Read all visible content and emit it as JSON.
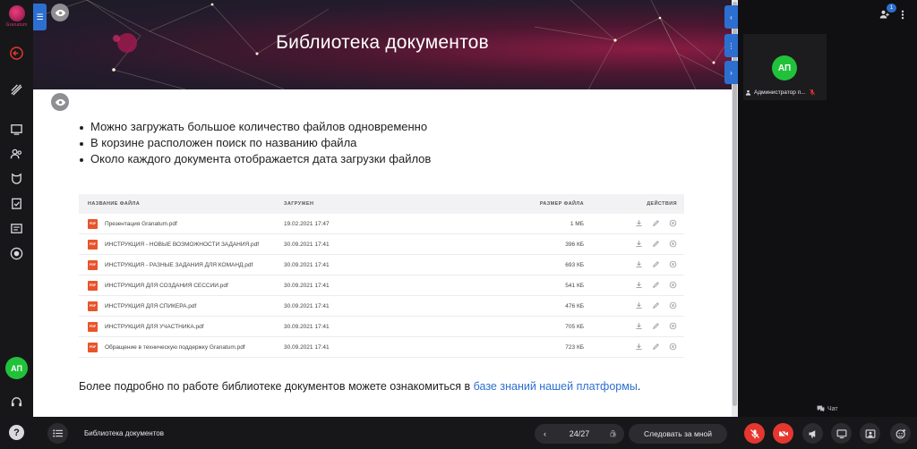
{
  "brand": {
    "name": "Granatum"
  },
  "slide": {
    "title": "Библиотека документов",
    "bullets": [
      "Можно загружать большое количество файлов одновременно",
      "В корзине расположен поиск по названию файла",
      "Около каждого документа отображается дата загрузки файлов"
    ],
    "table": {
      "headers": {
        "name": "НАЗВАНИЕ ФАЙЛА",
        "uploaded": "ЗАГРУЖЕН",
        "size": "РАЗМЕР ФАЙЛА",
        "actions": "ДЕЙСТВИЯ"
      },
      "file_badge": "PDF",
      "rows": [
        {
          "name": "Презентация Granatum.pdf",
          "uploaded": "19.02.2021 17:47",
          "size": "1 МБ"
        },
        {
          "name": "ИНСТРУКЦИЯ - НОВЫЕ ВОЗМОЖНОСТИ ЗАДАНИЯ.pdf",
          "uploaded": "30.09.2021 17:41",
          "size": "396 КБ"
        },
        {
          "name": "ИНСТРУКЦИЯ - РАЗНЫЕ ЗАДАНИЯ ДЛЯ КОМАНД.pdf",
          "uploaded": "30.09.2021 17:41",
          "size": "693 КБ"
        },
        {
          "name": "ИНСТРУКЦИЯ ДЛЯ СОЗДАНИЯ СЕССИИ.pdf",
          "uploaded": "30.09.2021 17:41",
          "size": "541 КБ"
        },
        {
          "name": "ИНСТРУКЦИЯ ДЛЯ СПИКЕРА.pdf",
          "uploaded": "30.09.2021 17:41",
          "size": "476 КБ"
        },
        {
          "name": "ИНСТРУКЦИЯ ДЛЯ УЧАСТНИКА.pdf",
          "uploaded": "30.09.2021 17:41",
          "size": "705 КБ"
        },
        {
          "name": "Обращение в техническую поддержку Granatum.pdf",
          "uploaded": "30.09.2021 17:41",
          "size": "723 КБ"
        }
      ]
    },
    "footer": {
      "text": "Более подробно по работе библиотеке документов можете ознакомиться в ",
      "link": "базе знаний нашей платформы",
      "end": "."
    }
  },
  "sidebar": {
    "avatar_initials": "АП"
  },
  "participants": {
    "count_badge": "1",
    "tile": {
      "initials": "АП",
      "name": "Администратор п..."
    }
  },
  "chat": {
    "label": "Чат"
  },
  "bottom_bar": {
    "document_title": "Библиотека документов",
    "page_indicator": "24/27",
    "follow_label": "Следовать за мной"
  },
  "colors": {
    "accent": "#2d6fd1",
    "danger": "#e5372f",
    "avatar": "#21c23a",
    "brand": "#d83a72"
  }
}
